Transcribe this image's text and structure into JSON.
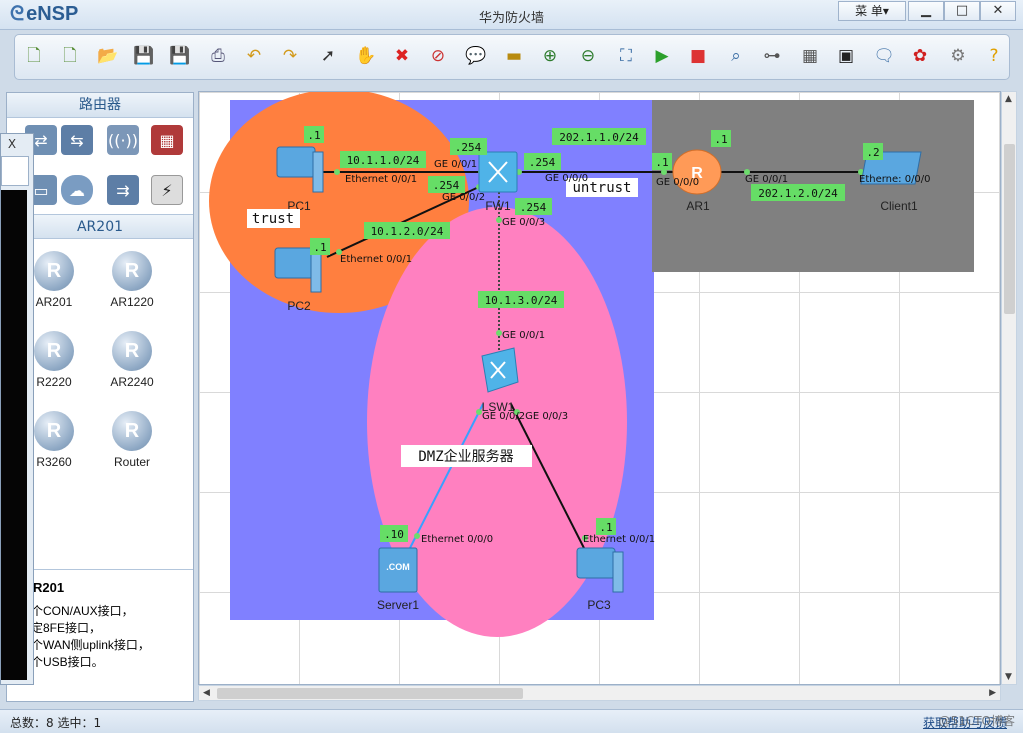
{
  "app": {
    "logo": "eNSP",
    "window_title": "华为防火墙",
    "menu_label": "菜 单▾",
    "minimize": "▁",
    "maximize": "□",
    "close": "✕"
  },
  "toolbar": {
    "icons": [
      "new-topology-icon",
      "new-template-icon",
      "open-icon",
      "save-icon",
      "save-as-icon",
      "print-icon",
      "undo-icon",
      "redo-icon",
      "select-pointer-icon",
      "pan-hand-icon",
      "delete-icon",
      "delete-link-icon",
      "text-note-icon",
      "rectangle-icon",
      "zoom-in-icon",
      "zoom-out-icon",
      "fit-screen-icon",
      "start-device-icon",
      "stop-device-icon",
      "capture-data-icon",
      "topology-view-icon",
      "interface-table-icon",
      "cli-console-icon",
      "forum-icon",
      "huawei-icon",
      "settings-icon",
      "help-icon"
    ]
  },
  "left_panel": {
    "category_title": "路由器",
    "subcategory_title": "AR201",
    "devices": [
      "AR201",
      "AR1220",
      "R2220",
      "AR2240",
      "R3260",
      "Router"
    ],
    "desc_title": "R201",
    "desc_lines": [
      "个CON/AUX接口，",
      "定8FE接口，",
      "个WAN侧uplink接口，",
      "个USB接口。"
    ],
    "overlay_close": "X"
  },
  "topology": {
    "zones": {
      "trust": "trust",
      "untrust": "untrust",
      "dmz": "DMZ企业服务器"
    },
    "devices": {
      "pc1": "PC1",
      "pc2": "PC2",
      "fw1": "FW1",
      "ar1": "AR1",
      "client1": "Client1",
      "lsw1": "LSW1",
      "server1": "Server1",
      "pc3": "PC3"
    },
    "ip_tags": {
      "pc1": ".1",
      "pc2": ".1",
      "fw1_g001": ".254",
      "fw1_g002": ".254",
      "fw1_g000": ".254",
      "fw1_g003": ".254",
      "ar1_g000": ".1",
      "ar1_g001": ".1",
      "client1": ".2",
      "server1": ".10",
      "pc3": ".1"
    },
    "subnets": {
      "net1": "10.1.1.0/24",
      "net2": "10.1.2.0/24",
      "net3": "10.1.3.0/24",
      "wan": "202.1.1.0/24",
      "client_net": "202.1.2.0/24"
    },
    "ports": {
      "pc1": "Ethernet 0/0/1",
      "pc2": "Ethernet 0/0/1",
      "fw1_a": "GE 0/0/1",
      "fw1_b": "GE 0/0/2",
      "fw1_c": "GE 0/0/0",
      "fw1_d": "GE 0/0/3",
      "ar1_a": "GE 0/0/0",
      "ar1_b": "GE 0/0/1",
      "client1": "Etherne: 0/0/0",
      "lsw1_up": "GE 0/0/1",
      "lsw1_down": "GE 0/0/2GE 0/0/3",
      "server1": "Ethernet 0/0/0",
      "pc3": "Ethernet 0/0/1"
    }
  },
  "status": {
    "summary": "总数：8 选中：1",
    "link": "获取帮助与反馈",
    "watermark": "@51CTO博客"
  },
  "colors": {
    "trust_zone": "#ff7f3f",
    "untrust_zone": "#808080",
    "dmz_zone": "#ff80c0",
    "canvas_bg_zone": "#8080ff",
    "label_green": "#66dd66"
  }
}
